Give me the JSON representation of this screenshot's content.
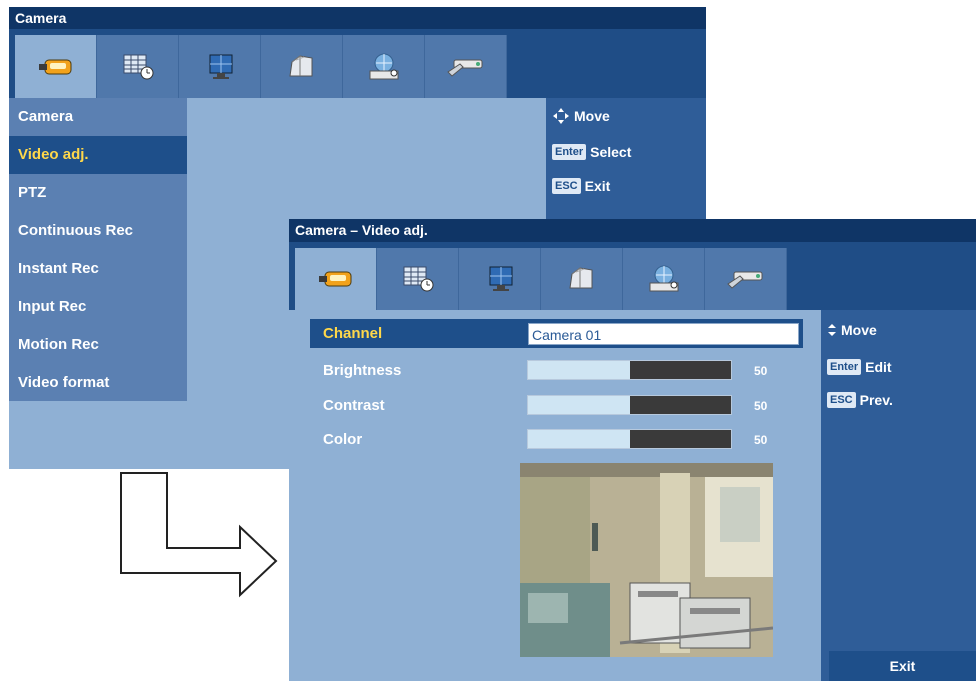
{
  "screen1": {
    "title": "Camera",
    "tabs": [
      {
        "icon": "camera-icon",
        "active": true
      },
      {
        "icon": "schedule-icon",
        "active": false
      },
      {
        "icon": "monitor-icon",
        "active": false
      },
      {
        "icon": "archive-icon",
        "active": false
      },
      {
        "icon": "network-icon",
        "active": false
      },
      {
        "icon": "tools-icon",
        "active": false
      }
    ],
    "menu": [
      {
        "label": "Camera"
      },
      {
        "label": "Video adj."
      },
      {
        "label": "PTZ"
      },
      {
        "label": "Continuous Rec"
      },
      {
        "label": "Instant Rec"
      },
      {
        "label": "Input Rec"
      },
      {
        "label": "Motion Rec"
      },
      {
        "label": "Video format"
      }
    ],
    "selected_menu": "Video adj.",
    "help": {
      "move": "Move",
      "enter_key": "Enter",
      "enter_action": "Select",
      "esc_key": "ESC",
      "esc_action": "Exit"
    }
  },
  "screen2": {
    "title": "Camera – Video adj.",
    "fields": {
      "channel": {
        "label": "Channel",
        "value": "Camera 01"
      },
      "brightness": {
        "label": "Brightness",
        "value": "50",
        "level": 0.5
      },
      "contrast": {
        "label": "Contrast",
        "value": "50",
        "level": 0.5
      },
      "color": {
        "label": "Color",
        "value": "50",
        "level": 0.5
      }
    },
    "help": {
      "move": "Move",
      "enter_key": "Enter",
      "enter_action": "Edit",
      "esc_key": "ESC",
      "esc_action": "Prev."
    },
    "exit_label": "Exit"
  },
  "colors": {
    "background": "#8fb0d4",
    "titlebar": "#0f3566",
    "selection": "#1e4f8a",
    "highlight_text": "#ffd84a"
  }
}
